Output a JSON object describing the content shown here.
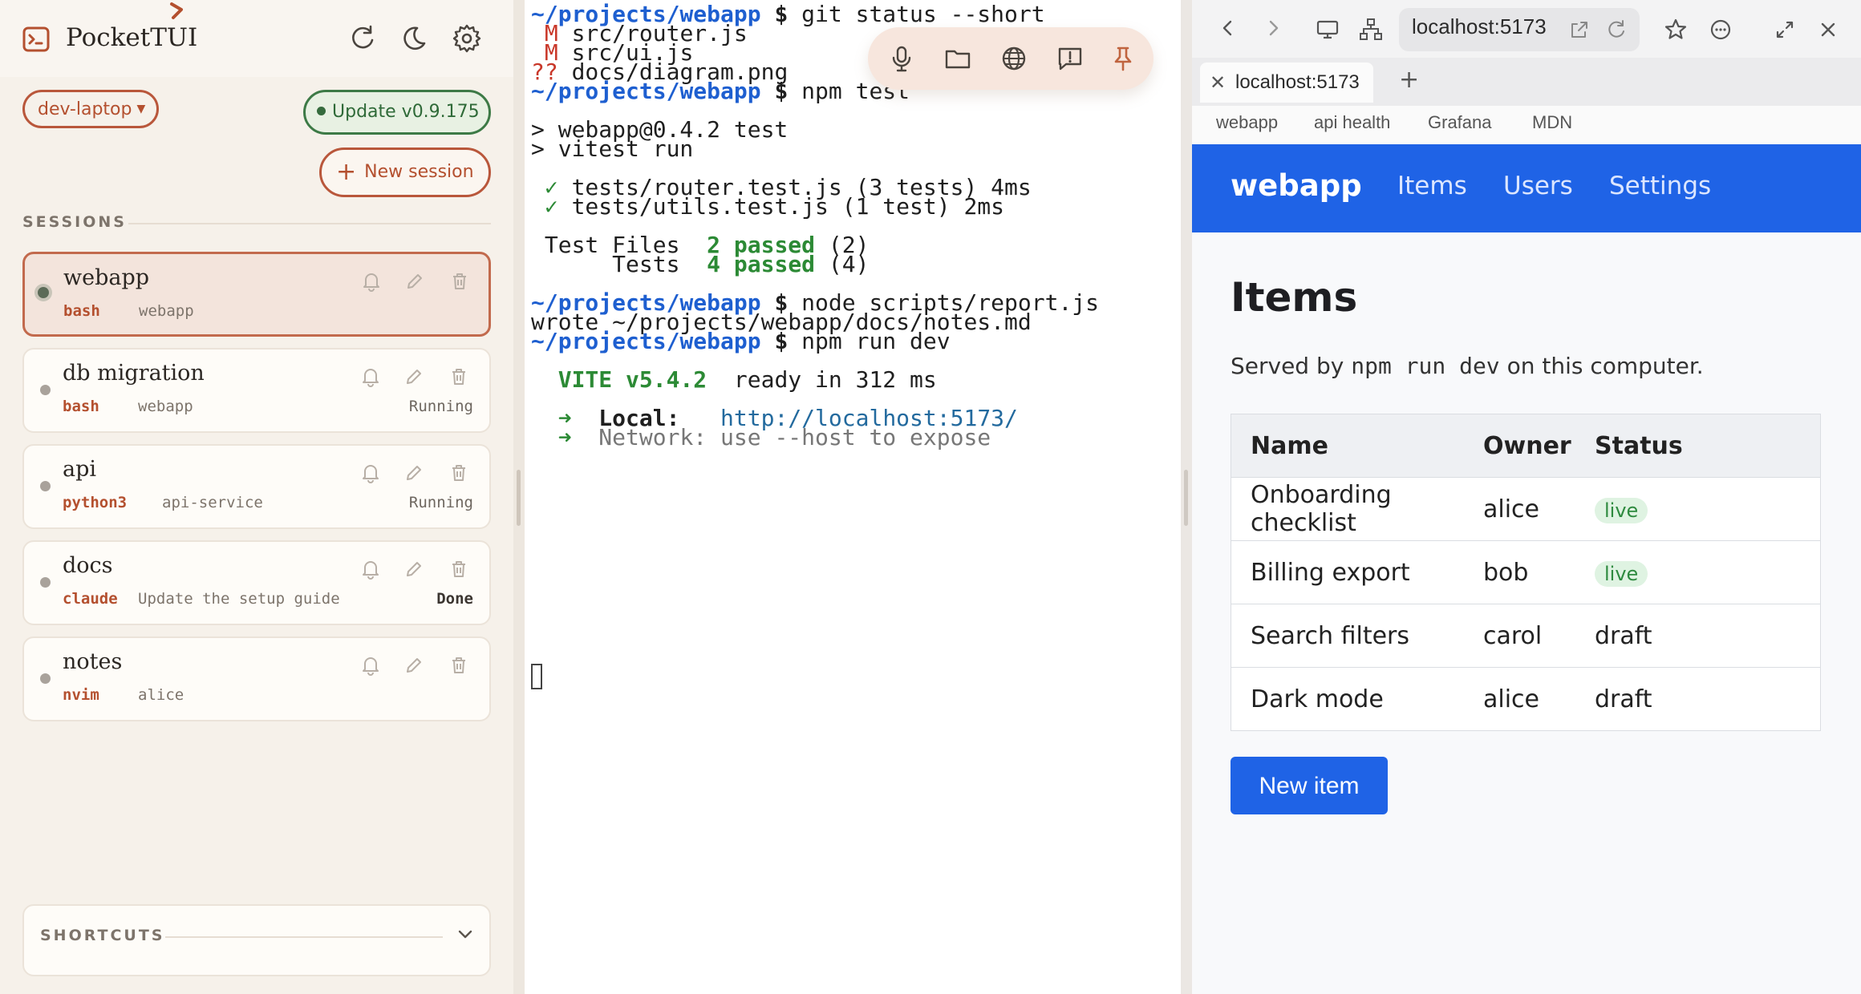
{
  "app": {
    "title": "PocketTUI"
  },
  "sidebar": {
    "host": "dev-laptop",
    "update_label": "Update v0.9.175",
    "new_session_label": "New session",
    "sessions_label": "SESSIONS",
    "sessions": [
      {
        "name": "webapp",
        "command": "bash",
        "directory": "webapp",
        "status": "",
        "active": true
      },
      {
        "name": "db migration",
        "command": "bash",
        "directory": "webapp",
        "status": "Running",
        "active": false
      },
      {
        "name": "api",
        "command": "python3",
        "directory": "api-service",
        "status": "Running",
        "active": false
      },
      {
        "name": "docs",
        "command": "claude",
        "directory": "Update the setup guide",
        "status": "Done",
        "active": false
      },
      {
        "name": "notes",
        "command": "nvim",
        "directory": "alice",
        "status": "",
        "active": false
      }
    ],
    "shortcuts_label": "SHORTCUTS"
  },
  "terminal": {
    "prompt": "~/projects/webapp",
    "lines": {
      "cmd1": "git status --short",
      "m1_flag": "M",
      "m1_file": "src/router.js",
      "m2_flag": "M",
      "m2_file": "src/ui.js",
      "u1_flag": "??",
      "u1_file": "docs/diagram.png",
      "cmd2": "npm test",
      "out1": "> webapp@0.4.2 test",
      "out2": "> vitest run",
      "check": "✓",
      "test1": "tests/router.test.js (3 tests) 4ms",
      "test2": "tests/utils.test.js (1 test) 2ms",
      "files_label": "Test Files",
      "files_passed": "2 passed",
      "files_total": "(2)",
      "tests_label": "Tests",
      "tests_passed": "4 passed",
      "tests_total": "(4)",
      "cmd3": "node scripts/report.js",
      "out3": "wrote ~/projects/webapp/docs/notes.md",
      "cmd4": "npm run dev",
      "vite": "VITE v5.4.2",
      "ready": "ready in 312 ms",
      "arrow": "➜",
      "local_label": "Local:",
      "local_url": "http://localhost:5173/",
      "network": "Network: use --host to expose"
    }
  },
  "browser": {
    "url": "localhost:5173",
    "tab_title": "localhost:5173",
    "bookmarks": [
      "webapp",
      "api health",
      "Grafana",
      "MDN"
    ],
    "page": {
      "brand": "webapp",
      "nav": [
        "Items",
        "Users",
        "Settings"
      ],
      "heading": "Items",
      "subtitle_pre": "Served by ",
      "subtitle_code": "npm run dev",
      "subtitle_post": " on this computer.",
      "table": {
        "headers": [
          "Name",
          "Owner",
          "Status"
        ],
        "rows": [
          {
            "name": "Onboarding checklist",
            "owner": "alice",
            "status": "live"
          },
          {
            "name": "Billing export",
            "owner": "bob",
            "status": "live"
          },
          {
            "name": "Search filters",
            "owner": "carol",
            "status": "draft"
          },
          {
            "name": "Dark mode",
            "owner": "alice",
            "status": "draft"
          }
        ]
      },
      "new_item_label": "New item"
    }
  },
  "colors": {
    "accent": "#b4502f",
    "update_green": "#2f6a38",
    "prompt_blue": "#1e5fd0",
    "browser_primary": "#1f63e6"
  }
}
